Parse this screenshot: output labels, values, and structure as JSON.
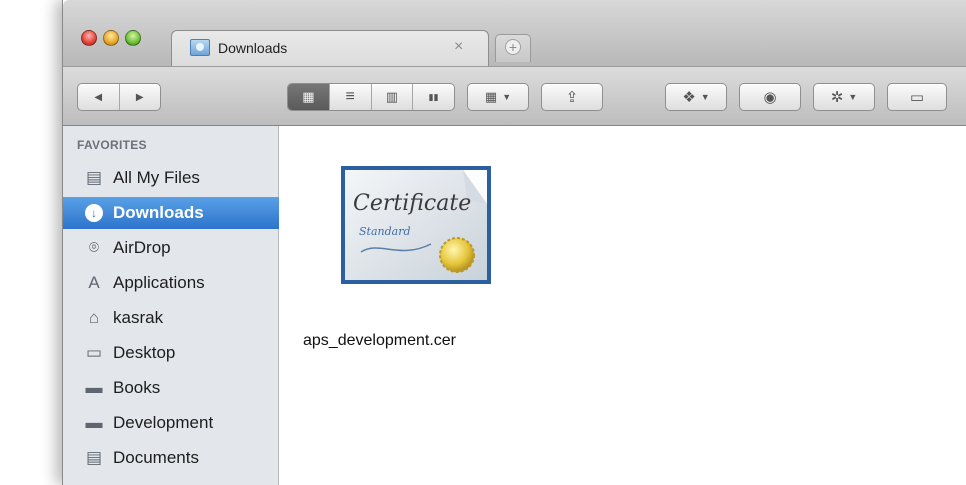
{
  "titlebar": {
    "tab_title": "Downloads",
    "tab_close": "×",
    "new_tab": "+"
  },
  "toolbar": {
    "back": "◀",
    "forward": "▶",
    "view_icon": "▦",
    "view_list": "≡",
    "view_columns": "▥",
    "view_coverflow": "▮▮",
    "arrange": "▦",
    "share": "⇪",
    "dropbox": "❖",
    "quicklook": "◉",
    "action": "✲",
    "new_folder": "▭"
  },
  "sidebar": {
    "header": "FAVORITES",
    "items": [
      {
        "label": "All My Files",
        "icon": "▤"
      },
      {
        "label": "Downloads",
        "icon": "↓",
        "selected": true
      },
      {
        "label": "AirDrop",
        "icon": "⌾"
      },
      {
        "label": "Applications",
        "icon": "A"
      },
      {
        "label": "kasrak",
        "icon": "⌂"
      },
      {
        "label": "Desktop",
        "icon": "▭"
      },
      {
        "label": "Books",
        "icon": "▬"
      },
      {
        "label": "Development",
        "icon": "▬"
      },
      {
        "label": "Documents",
        "icon": "▤"
      }
    ]
  },
  "content": {
    "file_name": "aps_development.cer",
    "cert_line1": "Certificate",
    "cert_line2": "Standard"
  },
  "colors": {
    "selection": "#2d74cc",
    "sidebar_bg": "#e3e7ec"
  }
}
